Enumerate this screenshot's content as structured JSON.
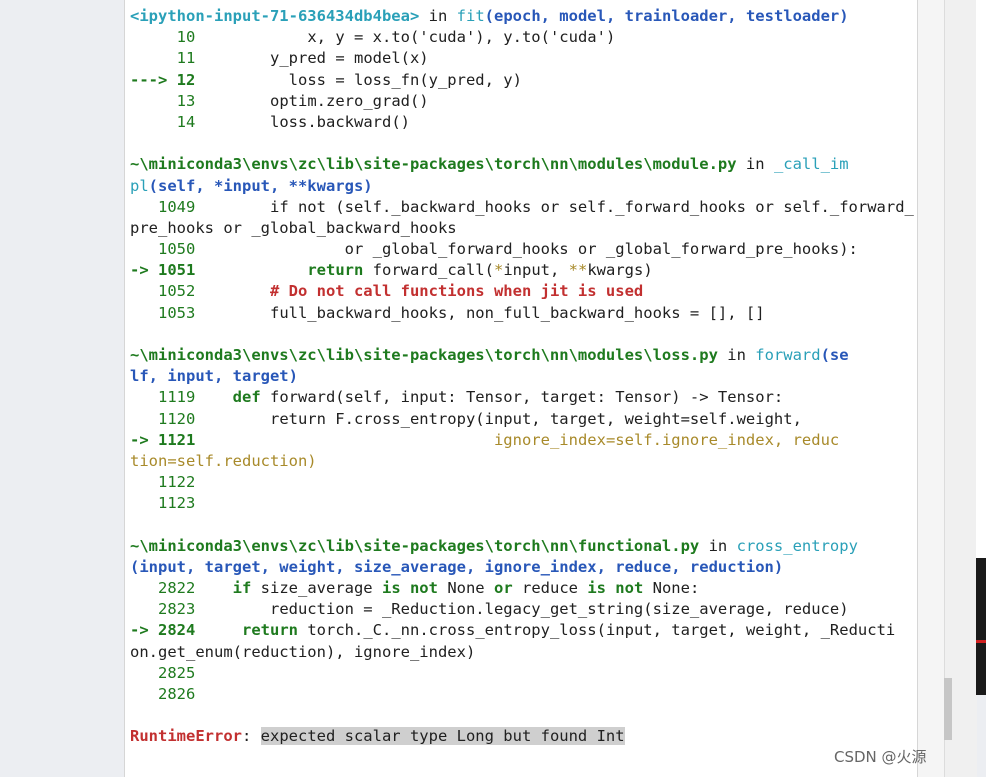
{
  "traceback": {
    "f1_header": {
      "file": "<ipython-input-71-636434db4bea>",
      "in": "in",
      "func": "fit",
      "args": "(epoch, model, trainloader, testloader)"
    },
    "f1_lines": [
      {
        "num": "10",
        "code": "x, y = x.to('cuda'), y.to('cuda')"
      },
      {
        "num": "11",
        "code": "y_pred = model(x)"
      },
      {
        "num": "12",
        "code": "loss = loss_fn(y_pred, y)"
      },
      {
        "num": "13",
        "code": "optim.zero_grad()"
      },
      {
        "num": "14",
        "code": "loss.backward()"
      }
    ],
    "f2_path": "~\\miniconda3\\envs\\zc\\lib\\site-packages\\torch\\nn\\modules\\module.py",
    "f2_in": "in",
    "f2_func_a": "_call_im",
    "f2_func_b": "pl",
    "f2_args": "(self, *input, **kwargs)",
    "f2_lines": [
      {
        "num": "1049",
        "code": "if not (self._backward_hooks or self._forward_hooks or self._forward_"
      },
      {
        "num": "",
        "code": "pre_hooks or _global_backward_hooks"
      },
      {
        "num": "1050",
        "code": "or _global_forward_hooks or _global_forward_pre_hooks):"
      },
      {
        "num": "1051",
        "code": "return forward_call(*input, **kwargs)"
      },
      {
        "num": "1052",
        "code": "# Do not call functions when jit is used"
      },
      {
        "num": "1053",
        "code": "full_backward_hooks, non_full_backward_hooks = [], []"
      }
    ],
    "f3_path": "~\\miniconda3\\envs\\zc\\lib\\site-packages\\torch\\nn\\modules\\loss.py",
    "f3_in": "in",
    "f3_func_a": "forward",
    "f3_args_a": "(se",
    "f3_args_b": "lf, input, target)",
    "f3_lines": [
      {
        "num": "1119",
        "code": "def forward(self, input: Tensor, target: Tensor) -> Tensor:"
      },
      {
        "num": "1120",
        "code": "return F.cross_entropy(input, target, weight=self.weight,"
      },
      {
        "num": "1121",
        "code": "ignore_index=self.ignore_index, reduc"
      },
      {
        "num": "",
        "code": "tion=self.reduction)"
      },
      {
        "num": "1122",
        "code": ""
      },
      {
        "num": "1123",
        "code": ""
      }
    ],
    "f4_path": "~\\miniconda3\\envs\\zc\\lib\\site-packages\\torch\\nn\\functional.py",
    "f4_in": "in",
    "f4_func": "cross_entropy",
    "f4_args": "(input, target, weight, size_average, ignore_index, reduce, reduction)",
    "f4_lines": [
      {
        "num": "2822",
        "code": "if size_average is not None or reduce is not None:"
      },
      {
        "num": "2823",
        "code": "reduction = _Reduction.legacy_get_string(size_average, reduce)"
      },
      {
        "num": "2824",
        "code": "return torch._C._nn.cross_entropy_loss(input, target, weight, _Reducti"
      },
      {
        "num": "",
        "code": "on.get_enum(reduction), ignore_index)"
      },
      {
        "num": "2825",
        "code": ""
      },
      {
        "num": "2826",
        "code": ""
      }
    ],
    "arrow_long": "--->",
    "arrow_short": "->",
    "error_type": "RuntimeError",
    "error_msg": "expected scalar type Long but found Int"
  },
  "watermark": "CSDN @火源"
}
